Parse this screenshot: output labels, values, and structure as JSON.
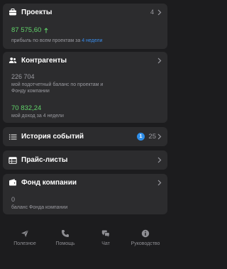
{
  "colors": {
    "background": "#1c1c1e",
    "card": "#2c2c2e",
    "positive": "#61d26a",
    "link": "#3a8eed",
    "muted": "#9a9aa0",
    "badge": "#2f8ee9"
  },
  "projects": {
    "icon": "briefcase-icon",
    "title": "Проекты",
    "count": "4",
    "amount": "87 575,60",
    "trend_icon": "arrow-up-icon",
    "caption_prefix": "прибыль по всем проектам за",
    "caption_period": "4 недели"
  },
  "contractors": {
    "icon": "people-icon",
    "title": "Контрагенты",
    "balance_value": "226 704",
    "balance_caption_1": "мой подотчетный баланс по проектам и",
    "balance_caption_2": "Фонду компании",
    "income_value": "70 832,24",
    "income_caption": "мой доход за 4 недели"
  },
  "history": {
    "icon": "list-icon",
    "title": "История событий",
    "badge": "1",
    "count": "25"
  },
  "pricelists": {
    "icon": "table-icon",
    "title": "Прайс-листы"
  },
  "fund": {
    "icon": "wallet-icon",
    "title": "Фонд компании",
    "value": "0",
    "caption": "баланс Фонда компании"
  },
  "tabs": [
    {
      "icon": "paper-plane-icon",
      "label": "Полезное"
    },
    {
      "icon": "phone-icon",
      "label": "Помощь"
    },
    {
      "icon": "chat-bubbles-icon",
      "label": "Чат"
    },
    {
      "icon": "info-icon",
      "label": "Руководство"
    }
  ]
}
